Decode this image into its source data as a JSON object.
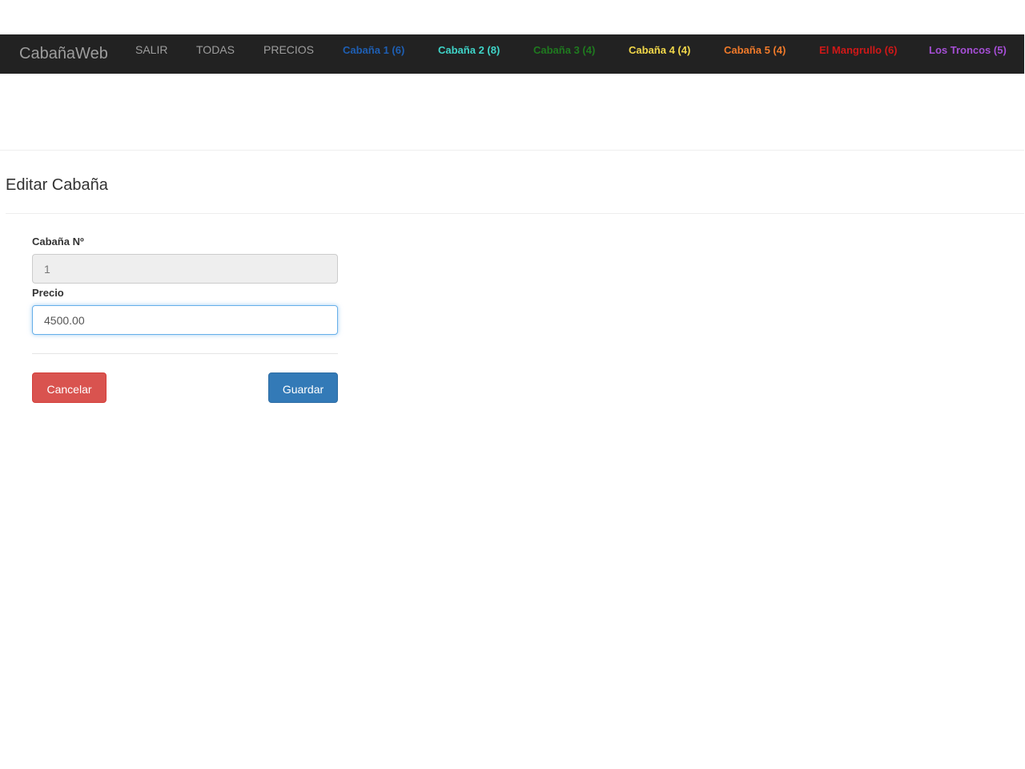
{
  "navbar": {
    "brand": "CabañaWeb",
    "links": [
      {
        "label": "SALIR",
        "color": "#9d9d9d"
      },
      {
        "label": "TODAS",
        "color": "#9d9d9d"
      },
      {
        "label": "PRECIOS",
        "color": "#9d9d9d"
      }
    ],
    "cabins": [
      {
        "label": "Cabaña 1 (6)",
        "color": "#1e5fb4"
      },
      {
        "label": "Cabaña 2 (8)",
        "color": "#3fd4c8"
      },
      {
        "label": "Cabaña 3 (4)",
        "color": "#1f7a1f"
      },
      {
        "label": "Cabaña 4 (4)",
        "color": "#f2d84a"
      },
      {
        "label": "Cabaña 5 (4)",
        "color": "#f07a2a"
      },
      {
        "label": "El Mangrullo (6)",
        "color": "#d01818"
      },
      {
        "label": "Los Troncos (5)",
        "color": "#a64fd6"
      }
    ]
  },
  "page": {
    "title": "Editar Cabaña"
  },
  "form": {
    "cabin_number_label": "Cabaña Nº",
    "cabin_number_value": "1",
    "price_label": "Precio",
    "price_value": "4500.00",
    "cancel_label": "Cancelar",
    "save_label": "Guardar"
  },
  "colors": {
    "navbar_bg": "#222222",
    "cancel_button": "#d9534f",
    "save_button": "#337ab7"
  }
}
